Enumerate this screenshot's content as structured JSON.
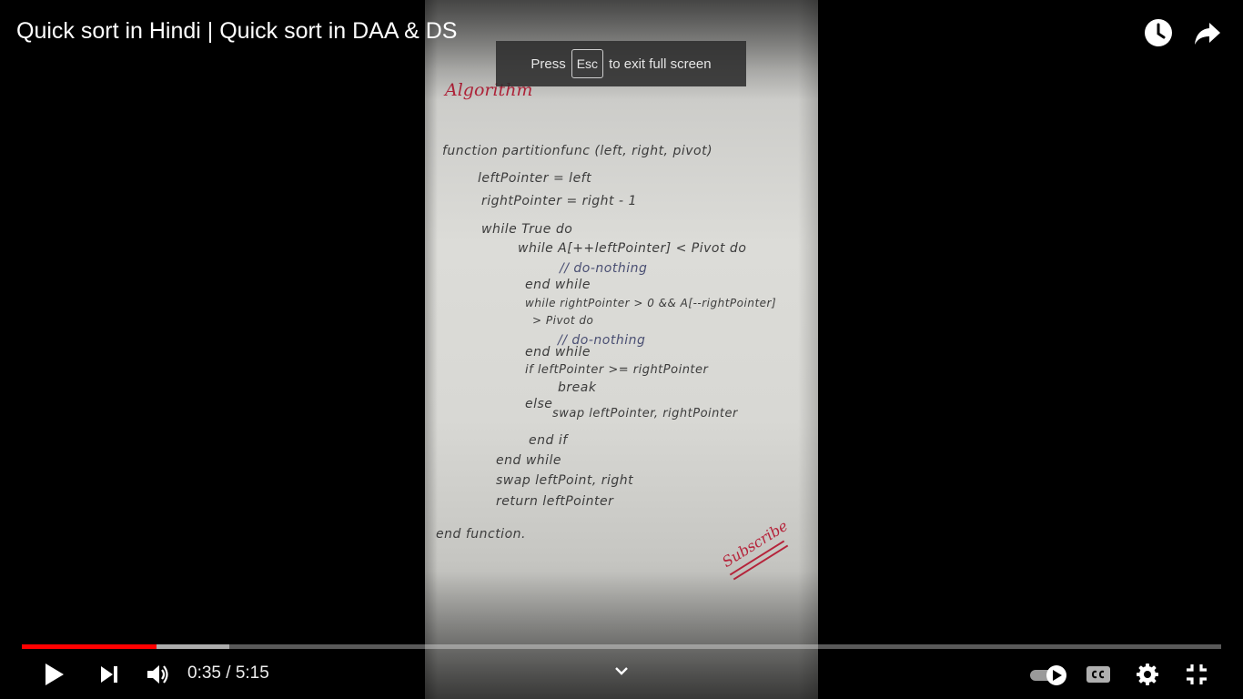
{
  "title": "Quick sort in Hindi | Quick sort in DAA & DS",
  "toast": {
    "prefix": "Press",
    "key": "Esc",
    "suffix": "to exit full screen"
  },
  "time": {
    "current": "0:35",
    "separator": "/",
    "duration": "5:15"
  },
  "progress": {
    "played_fraction": 0.112,
    "buffered_fraction": 0.173
  },
  "icons": {
    "watch_later": "clock-icon",
    "share": "share-icon",
    "play": "play-icon",
    "next": "next-icon",
    "volume": "volume-icon",
    "expand": "chevron-down-icon",
    "autoplay": "autoplay-toggle-icon",
    "captions": "captions-icon",
    "settings": "gear-icon",
    "exit_fullscreen": "exit-fullscreen-icon"
  },
  "colors": {
    "progress_played": "#ff0000",
    "handwriting_red": "#b5233a"
  },
  "video_content": {
    "heading": "Algorithm",
    "lines": [
      "function partitionfunc (left, right, pivot)",
      "leftPointer = left",
      "rightPointer = right - 1",
      "while True do",
      "while A[++leftPointer] < Pivot do",
      "// do-nothing",
      "end while",
      "while rightPointer > 0 && A[--rightPointer]",
      "> Pivot do",
      "// do-nothing",
      "end while",
      "if leftPointer >= rightPointer",
      "break",
      "else",
      "swap leftPointer, rightPointer",
      "end if",
      "end while",
      "swap leftPoint, right",
      "return leftPointer",
      "end function."
    ],
    "signature": "Subscribe"
  }
}
